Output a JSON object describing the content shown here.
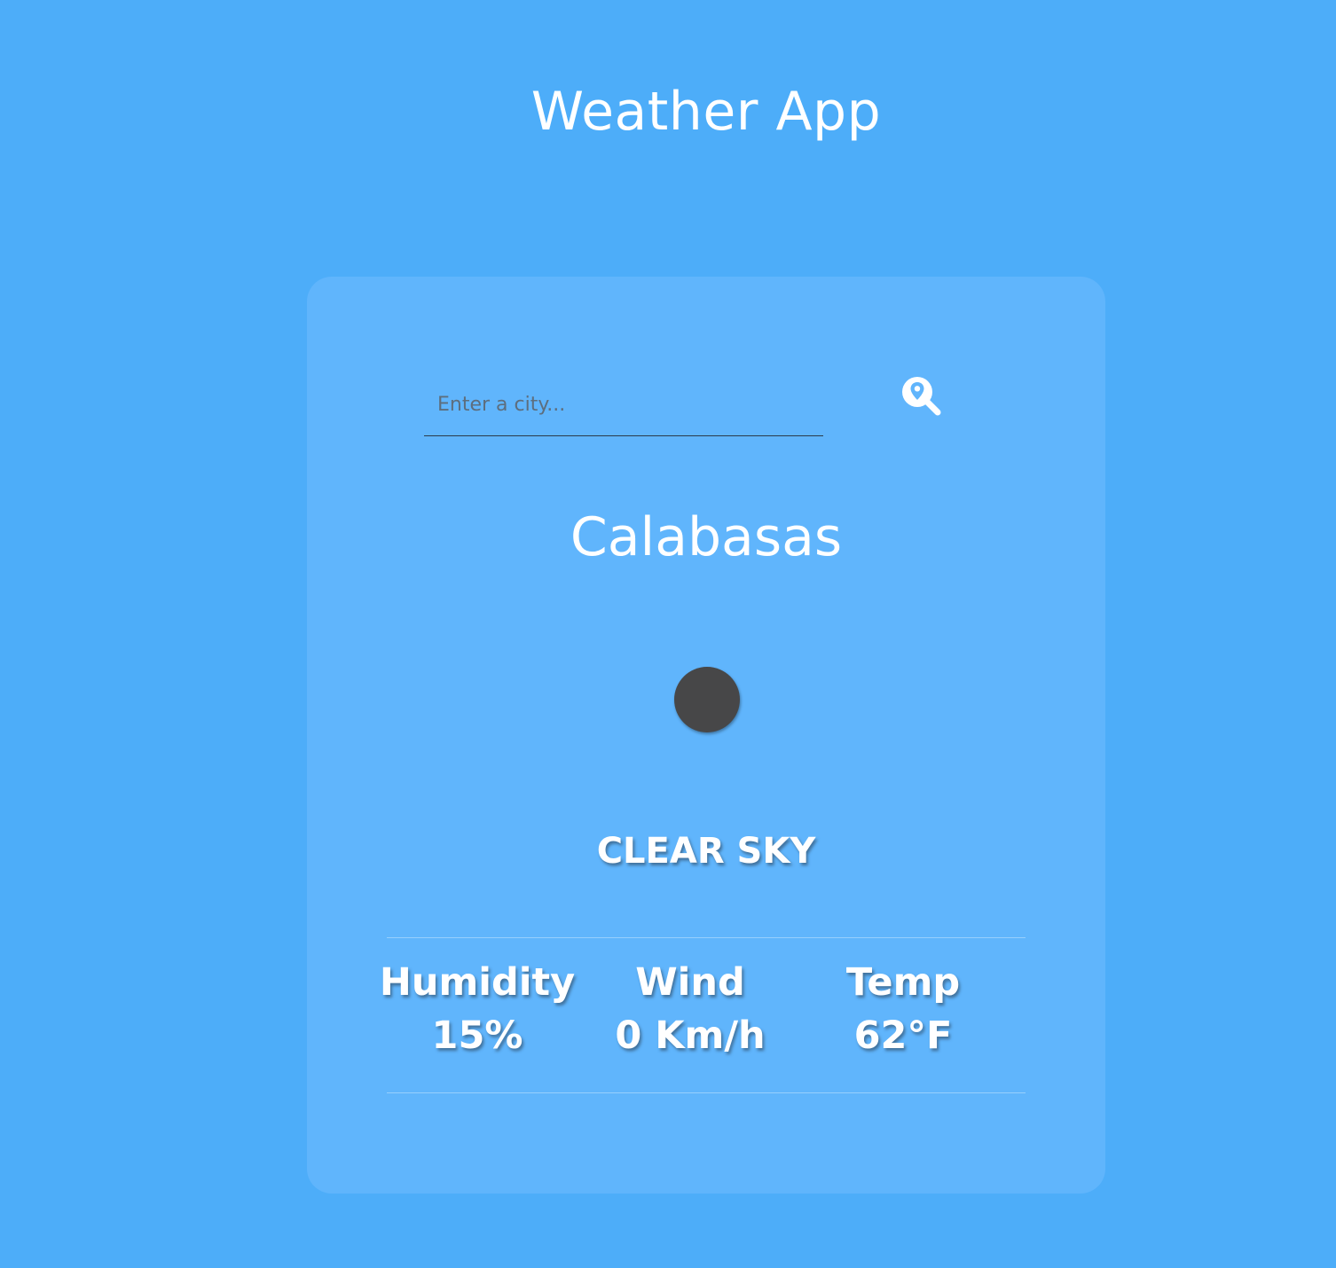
{
  "app": {
    "title": "Weather App"
  },
  "search": {
    "placeholder": "Enter a city...",
    "value": "",
    "icon": "location-search-icon"
  },
  "weather": {
    "city": "Calabasas",
    "icon": "weather-icon",
    "description": "CLEAR SKY"
  },
  "stats": [
    {
      "label": "Humidity",
      "value": "15%"
    },
    {
      "label": "Wind",
      "value": "0 Km/h"
    },
    {
      "label": "Temp",
      "value": "62°F"
    }
  ],
  "colors": {
    "background": "#4DADF9",
    "card": "#60B5FC",
    "text": "#FFFFFF",
    "icon_fill": "#474748"
  }
}
